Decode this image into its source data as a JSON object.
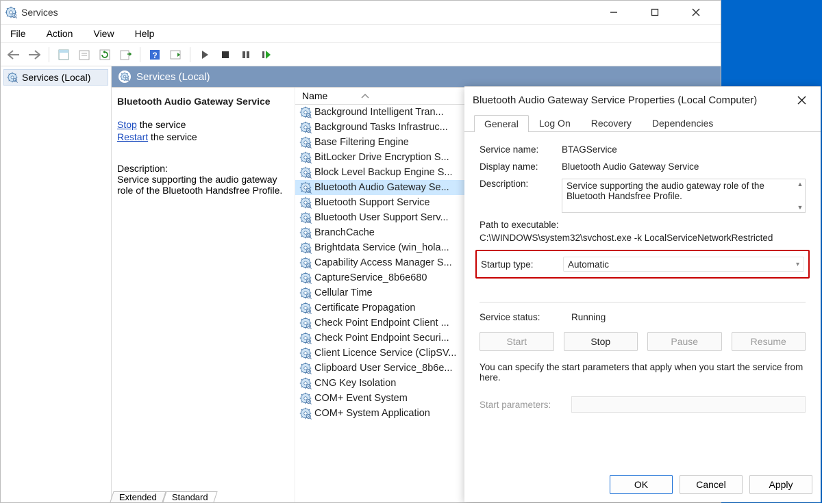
{
  "window": {
    "title": "Services",
    "menu": [
      "File",
      "Action",
      "View",
      "Help"
    ],
    "tree_node": "Services (Local)",
    "right_header": "Services (Local)",
    "bottom_tabs": [
      "Extended",
      "Standard"
    ]
  },
  "detail": {
    "title": "Bluetooth Audio Gateway Service",
    "stop_link": "Stop",
    "stop_suffix": " the service",
    "restart_link": "Restart",
    "restart_suffix": " the service",
    "desc_label": "Description:",
    "desc_text": "Service supporting the audio gateway role of the Bluetooth Handsfree Profile."
  },
  "list": {
    "column": "Name",
    "items": [
      "Background Intelligent Tran...",
      "Background Tasks Infrastruc...",
      "Base Filtering Engine",
      "BitLocker Drive Encryption S...",
      "Block Level Backup Engine S...",
      "Bluetooth Audio Gateway Se...",
      "Bluetooth Support Service",
      "Bluetooth User Support Serv...",
      "BranchCache",
      "Brightdata Service (win_hola...",
      "Capability Access Manager S...",
      "CaptureService_8b6e680",
      "Cellular Time",
      "Certificate Propagation",
      "Check Point Endpoint Client ...",
      "Check Point Endpoint Securi...",
      "Client Licence Service (ClipSV...",
      "Clipboard User Service_8b6e...",
      "CNG Key Isolation",
      "COM+ Event System",
      "COM+ System Application"
    ],
    "selected_index": 5
  },
  "dialog": {
    "title": "Bluetooth Audio Gateway Service Properties (Local Computer)",
    "tabs": [
      "General",
      "Log On",
      "Recovery",
      "Dependencies"
    ],
    "labels": {
      "service_name": "Service name:",
      "display_name": "Display name:",
      "description": "Description:",
      "path": "Path to executable:",
      "startup_type": "Startup type:",
      "service_status": "Service status:",
      "start_parameters": "Start parameters:"
    },
    "values": {
      "service_name": "BTAGService",
      "display_name": "Bluetooth Audio Gateway Service",
      "description": "Service supporting the audio gateway role of the Bluetooth Handsfree Profile.",
      "path": "C:\\WINDOWS\\system32\\svchost.exe -k LocalServiceNetworkRestricted",
      "startup_type": "Automatic",
      "service_status": "Running"
    },
    "hint": "You can specify the start parameters that apply when you start the service from here.",
    "buttons": {
      "start": "Start",
      "stop": "Stop",
      "pause": "Pause",
      "resume": "Resume",
      "ok": "OK",
      "cancel": "Cancel",
      "apply": "Apply"
    }
  }
}
